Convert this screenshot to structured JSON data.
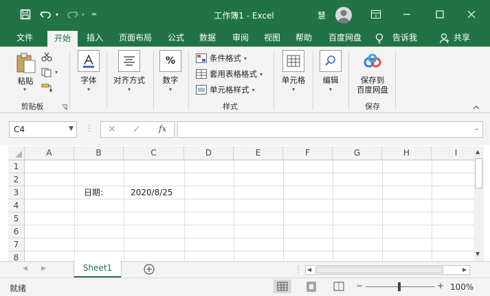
{
  "titlebar": {
    "title": "工作簿1 - Excel",
    "user_name": "慧",
    "icons": [
      "save-icon",
      "undo-icon",
      "redo-icon",
      "customize-icon",
      "avatar-icon",
      "ribbon-display-icon",
      "minimize-icon",
      "maximize-icon",
      "close-icon"
    ]
  },
  "tabs": {
    "file": "文件",
    "home": "开始",
    "insert": "插入",
    "page_layout": "页面布局",
    "formulas": "公式",
    "data": "数据",
    "review": "审阅",
    "view": "视图",
    "help": "帮助",
    "baidu": "百度网盘",
    "tell_me": "告诉我",
    "share": "共享"
  },
  "ribbon": {
    "paste": "粘贴",
    "clipboard": "剪贴板",
    "font": "字体",
    "alignment": "对齐方式",
    "number": "数字",
    "number_icon": "%",
    "conditional_format": "条件格式",
    "format_as_table": "套用表格格式",
    "cell_styles": "单元格样式",
    "styles": "样式",
    "cells": "单元格",
    "editing": "编辑",
    "save_to": "保存到",
    "baidu_disk": "百度网盘",
    "save": "保存"
  },
  "formula_bar": {
    "name_box": "C4",
    "formula": "",
    "fx": "fx"
  },
  "grid": {
    "columns": [
      "A",
      "B",
      "C",
      "D",
      "E",
      "F",
      "G",
      "H",
      "I"
    ],
    "rows": [
      "1",
      "2",
      "3",
      "4",
      "5",
      "6",
      "7",
      "8"
    ],
    "cells": {
      "B3": "日期:",
      "C3": "2020/8/25"
    }
  },
  "sheets": {
    "active": "Sheet1"
  },
  "status": {
    "ready": "就绪",
    "zoom": "100%",
    "zoom_minus": "−",
    "zoom_plus": "+"
  },
  "colors": {
    "brand": "#217346",
    "ribbon_bg": "#f3f3f3"
  }
}
